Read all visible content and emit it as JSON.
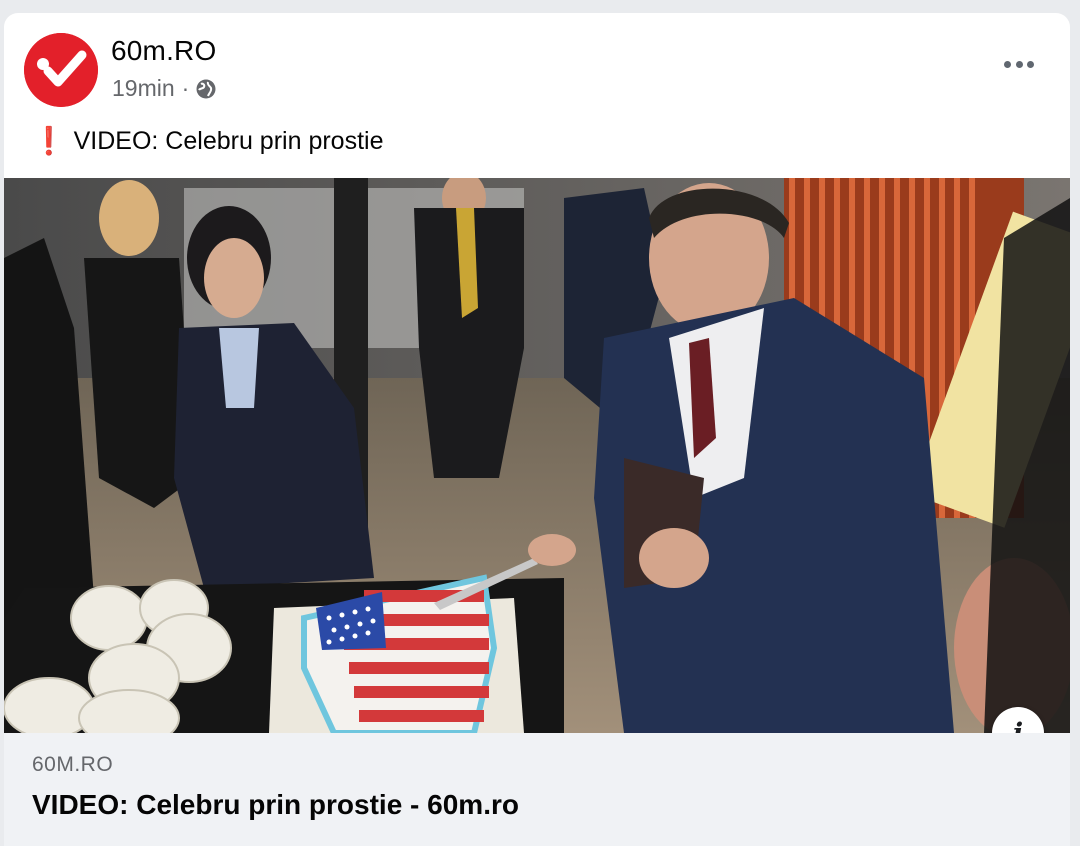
{
  "post": {
    "page_name": "60m.RO",
    "time": "19min",
    "separator": "·",
    "privacy_icon": "globe-icon",
    "more_icon": "more-options-icon",
    "alert_icon": "❗",
    "text": "VIDEO: Celebru prin prostie"
  },
  "media": {
    "info_label": "i"
  },
  "link_preview": {
    "domain": "60M.RO",
    "title": "VIDEO: Celebru prin prostie - 60m.ro"
  },
  "colors": {
    "brand_red": "#e3202a",
    "secondary_text": "#65676b",
    "preview_bg": "#f0f2f5"
  }
}
